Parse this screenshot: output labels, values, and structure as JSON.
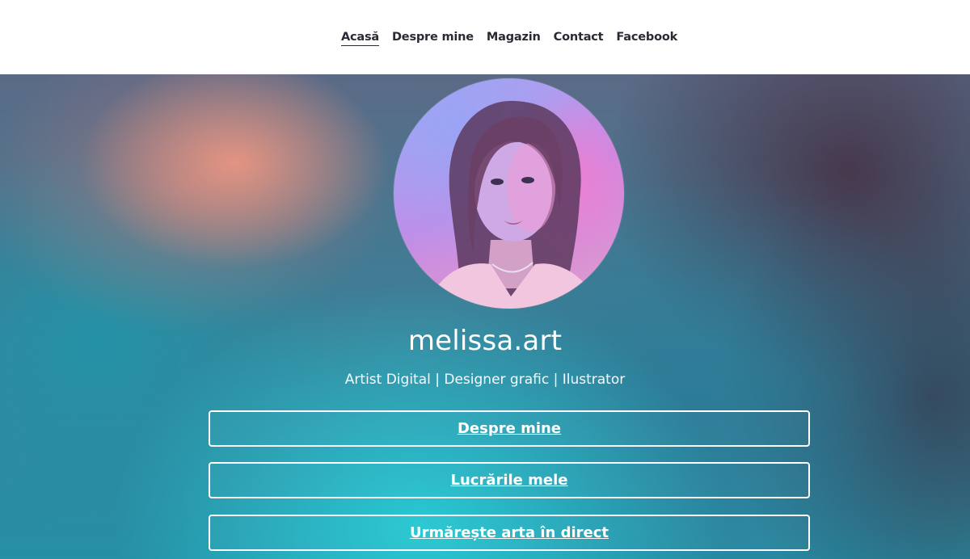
{
  "nav": {
    "items": [
      {
        "label": "Acasă",
        "active": true
      },
      {
        "label": "Despre mine",
        "active": false
      },
      {
        "label": "Magazin",
        "active": false
      },
      {
        "label": "Contact",
        "active": false
      },
      {
        "label": "Facebook",
        "active": false
      }
    ]
  },
  "profile": {
    "name": "melissa.art",
    "tagline": "Artist Digital | Designer grafic | Ilustrator"
  },
  "links": [
    {
      "label": "Despre mine"
    },
    {
      "label": "Lucrările mele"
    },
    {
      "label": "Urmărește arta în direct"
    }
  ],
  "colors": {
    "nav_text": "#2a2a35",
    "hero_text": "#ffffff",
    "button_border": "#ffffff"
  }
}
